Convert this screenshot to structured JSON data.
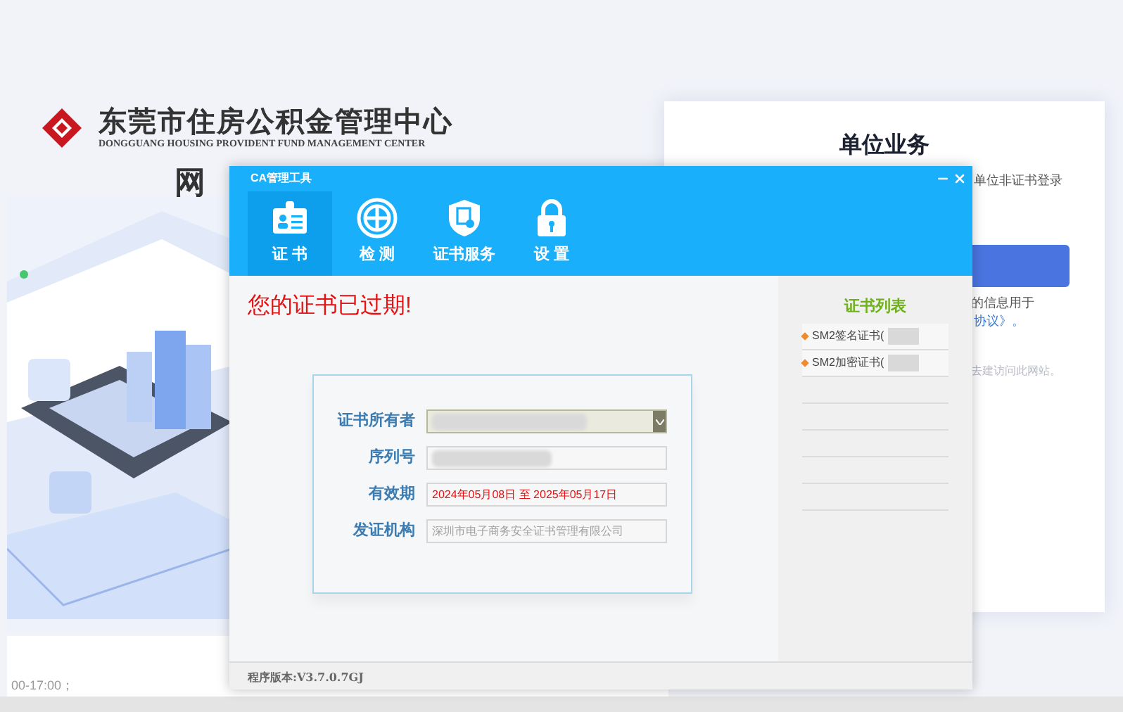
{
  "background_page": {
    "logo_title": "东莞市住房公积金管理中心",
    "logo_subtitle": "DONGGUANG HOUSING PROVIDENT FUND MANAGEMENT CENTER",
    "heading": "网",
    "card": {
      "title": "单位业务",
      "login_text": "单位非证书登录",
      "notice_text": "的信息用于",
      "agreement_link": "协议》。",
      "hint_text": "去建访问此网站。"
    },
    "footer_text": "00-17:00；"
  },
  "ca_window": {
    "title": "CA管理工具",
    "tabs": [
      {
        "label": "证 书",
        "selected": true
      },
      {
        "label": "检 测",
        "selected": false
      },
      {
        "label": "证书服务",
        "selected": false
      },
      {
        "label": "设 置",
        "selected": false
      }
    ],
    "message": "您的证书已过期!",
    "fields": [
      {
        "label": "证书所有者",
        "kind": "select",
        "redacted": true
      },
      {
        "label": "序列号",
        "kind": "text",
        "redacted": true
      },
      {
        "label": "有效期",
        "kind": "text",
        "value": "2024年05月08日 至 2025年05月17日",
        "alert": true
      },
      {
        "label": "发证机构",
        "kind": "text",
        "value": "深圳市电子商务安全证书管理有限公司",
        "alert": false
      }
    ],
    "cert_list": {
      "title": "证书列表",
      "items": [
        {
          "label": "SM2签名证书(",
          "redacted": true
        },
        {
          "label": "SM2加密证书(",
          "redacted": true
        }
      ]
    },
    "version": "程序版本:V3.7.0.7GJ"
  }
}
